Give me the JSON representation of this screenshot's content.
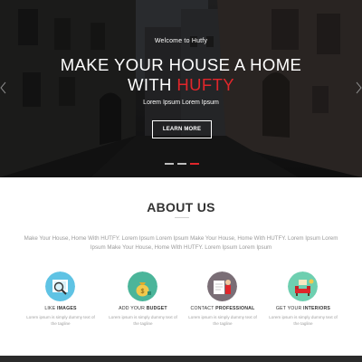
{
  "hero": {
    "welcome": "Welcome to Hutfy",
    "title_line1": "MAKE YOUR HOUSE A HOME",
    "title_line2_prefix": "WITH ",
    "title_brand": "HUFTY",
    "subtitle": "Lorem Ipsum Lorem Ipsum",
    "button_label": "LEARN MORE",
    "slides_total": 3,
    "active_slide": 3,
    "accent_color": "#e0262b"
  },
  "about": {
    "title": "ABOUT US",
    "text": "Make Your House, Home With HUTFY. Lorem Ipsum Lorem Ipsum Make Your House, Home With HUTFY. Lorem Ipsum Lorem Ipsum Make Your House, Home With HUTFY. Lorem Ipsum Lorem Ipsum"
  },
  "features": [
    {
      "icon": "magnifier-images-icon",
      "title_prefix": "LIKE ",
      "title_bold": "IMAGES",
      "desc": "Lorem ipsum is simply dummy text of the tagline",
      "color": "#5fc3e4"
    },
    {
      "icon": "money-bag-icon",
      "title_prefix": "ADD YOUR ",
      "title_bold": "BUDGET",
      "desc": "Lorem ipsum is simply dummy text of the tagline",
      "color": "#4bb59a"
    },
    {
      "icon": "professional-person-icon",
      "title_prefix": "CONTACT ",
      "title_bold": "PROFESSIONAL",
      "desc": "Lorem ipsum is simply dummy text of the tagline",
      "color": "#7a6e76"
    },
    {
      "icon": "interiors-room-icon",
      "title_prefix": "GET YOUR ",
      "title_bold": "INTERIORS",
      "desc": "Lorem ipsum is simply dummy text of the tagline",
      "color": "#6ecfb0"
    }
  ]
}
